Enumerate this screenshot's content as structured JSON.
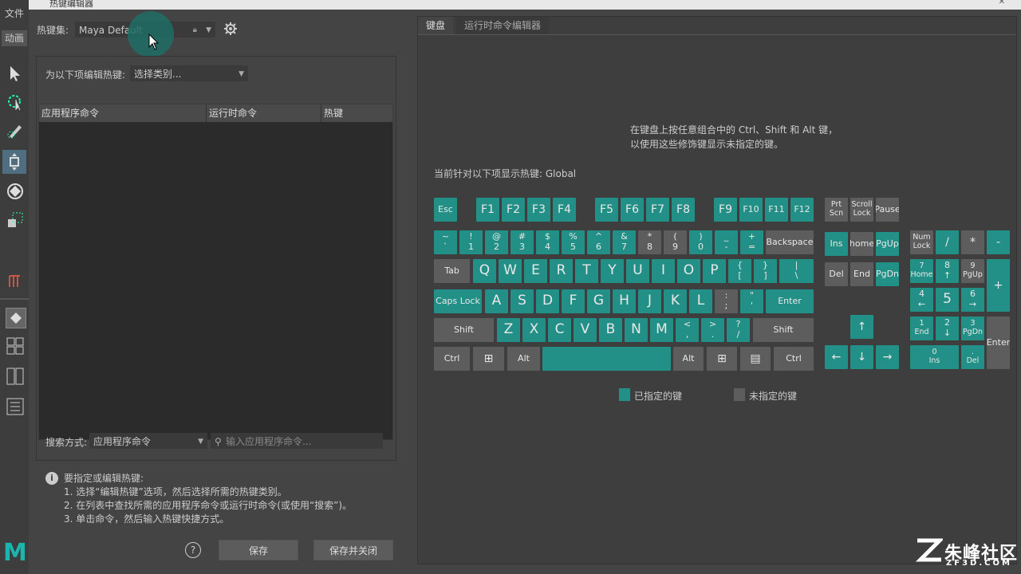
{
  "host": {
    "menu_label": "文件",
    "shelf_label": "动画"
  },
  "window": {
    "title": "热键编辑器"
  },
  "left": {
    "hotkey_set_label": "热键集:",
    "hotkey_set_value": "Maya Default",
    "edit_for_label": "为以下项编辑热键:",
    "category_value": "选择类别...",
    "columns": [
      "应用程序命令",
      "运行时命令",
      "热键"
    ],
    "search_label": "搜索方式:",
    "search_mode": "应用程序命令",
    "search_placeholder": "输入应用程序命令...",
    "help_title": "要指定或编辑热键:",
    "help_lines": [
      "1. 选择“编辑热键”选项，然后选择所需的热键类别。",
      "2. 在列表中查找所需的应用程序命令或运行时命令(或使用“搜索”)。",
      "3. 单击命令，然后输入热键快捷方式。"
    ],
    "help_btn": "?",
    "save": "保存",
    "save_close": "保存并关闭"
  },
  "right": {
    "tabs": [
      "键盘",
      "运行时命令编辑器"
    ],
    "hint": [
      "在键盘上按任意组合中的 Ctrl、Shift 和 Alt 键，",
      "以使用这些修饰键显示未指定的键。"
    ],
    "context": "当前针对以下项显示热键: Global",
    "legend_assigned": "已指定的键",
    "legend_unassigned": "未指定的键",
    "colors": {
      "assigned": "#229087",
      "unassigned": "#5d5d5d"
    }
  },
  "keys": {
    "esc": [
      "Esc"
    ],
    "f1": [
      "F1"
    ],
    "f2": [
      "F2"
    ],
    "f3": [
      "F3"
    ],
    "f4": [
      "F4"
    ],
    "f5": [
      "F5"
    ],
    "f6": [
      "F6"
    ],
    "f7": [
      "F7"
    ],
    "f8": [
      "F8"
    ],
    "f9": [
      "F9"
    ],
    "f10": [
      "F10"
    ],
    "f11": [
      "F11"
    ],
    "f12": [
      "F12"
    ],
    "prtscn": [
      "Prt",
      "Scn"
    ],
    "scroll": [
      "Scroll",
      "Lock"
    ],
    "pause": [
      "Pause"
    ],
    "tilde": [
      "~",
      "`"
    ],
    "k1": [
      "!",
      "1"
    ],
    "k2": [
      "@",
      "2"
    ],
    "k3": [
      "#",
      "3"
    ],
    "k4": [
      "$",
      "4"
    ],
    "k5": [
      "%",
      "5"
    ],
    "k6": [
      "^",
      "6"
    ],
    "k7": [
      "&",
      "7"
    ],
    "k8": [
      "*",
      "8"
    ],
    "k9": [
      "(",
      "9"
    ],
    "k0": [
      ")",
      "0"
    ],
    "minus": [
      "_",
      "-"
    ],
    "equal": [
      "+",
      "="
    ],
    "backspace": [
      "Backspace"
    ],
    "ins": [
      "Ins"
    ],
    "home": [
      "home"
    ],
    "pgup": [
      "PgUp"
    ],
    "numlock": [
      "Num",
      "Lock"
    ],
    "npdiv": [
      "/"
    ],
    "npmul": [
      "*"
    ],
    "npsub": [
      "-"
    ],
    "tab": [
      "Tab"
    ],
    "q": [
      "Q"
    ],
    "w": [
      "W"
    ],
    "e": [
      "E"
    ],
    "r": [
      "R"
    ],
    "t": [
      "T"
    ],
    "y": [
      "Y"
    ],
    "u": [
      "U"
    ],
    "i": [
      "I"
    ],
    "o": [
      "O"
    ],
    "p": [
      "P"
    ],
    "lbr": [
      "{",
      "["
    ],
    "rbr": [
      "}",
      "]"
    ],
    "bsl": [
      "|",
      "\\"
    ],
    "del": [
      "Del"
    ],
    "end": [
      "End"
    ],
    "pgdn": [
      "PgDn"
    ],
    "np7": [
      "7",
      "Home"
    ],
    "np8": [
      "8",
      "↑"
    ],
    "np9": [
      "9",
      "PgUp"
    ],
    "npadd": [
      "+"
    ],
    "caps": [
      "Caps Lock"
    ],
    "a": [
      "A"
    ],
    "s": [
      "S"
    ],
    "d": [
      "D"
    ],
    "f": [
      "F"
    ],
    "g": [
      "G"
    ],
    "h": [
      "H"
    ],
    "j": [
      "J"
    ],
    "k": [
      "K"
    ],
    "l": [
      "L"
    ],
    "semi": [
      ":",
      ";"
    ],
    "quote": [
      "\"",
      "'"
    ],
    "enter": [
      "Enter"
    ],
    "np4": [
      "4",
      "←"
    ],
    "np5": [
      "5"
    ],
    "np6": [
      "6",
      "→"
    ],
    "lshift": [
      "Shift"
    ],
    "z": [
      "Z"
    ],
    "x": [
      "X"
    ],
    "c": [
      "C"
    ],
    "v": [
      "V"
    ],
    "b": [
      "B"
    ],
    "n": [
      "N"
    ],
    "m": [
      "M"
    ],
    "comma": [
      "<",
      ","
    ],
    "period": [
      ">",
      "."
    ],
    "slash": [
      "?",
      "/"
    ],
    "rshift": [
      "Shift"
    ],
    "up": [
      "↑"
    ],
    "np1": [
      "1",
      "End"
    ],
    "np2": [
      "2",
      "↓"
    ],
    "np3": [
      "3",
      "PgDn"
    ],
    "npenter": [
      "Enter"
    ],
    "lctrl": [
      "Ctrl"
    ],
    "lwin": [
      "⊞"
    ],
    "lalt": [
      "Alt"
    ],
    "space": [
      ""
    ],
    "ralt": [
      "Alt"
    ],
    "rwin": [
      "⊞"
    ],
    "menu": [
      "▤"
    ],
    "rctrl": [
      "Ctrl"
    ],
    "left": [
      "←"
    ],
    "down": [
      "↓"
    ],
    "right": [
      "→"
    ],
    "np0": [
      "0",
      "Ins"
    ],
    "npdot": [
      ".",
      "Del"
    ]
  },
  "watermark": {
    "text": "朱峰社区",
    "url": "ZF3D.COM"
  }
}
